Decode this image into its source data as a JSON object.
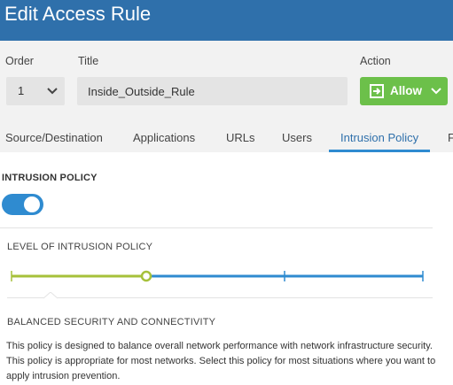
{
  "window": {
    "title": "Edit Access Rule"
  },
  "form": {
    "order_label": "Order",
    "order_value": "1",
    "title_label": "Title",
    "title_value": "Inside_Outside_Rule",
    "action_label": "Action",
    "action_value": "Allow"
  },
  "tabs": [
    {
      "label": "Source/Destination",
      "active": false
    },
    {
      "label": "Applications",
      "active": false
    },
    {
      "label": "URLs",
      "active": false
    },
    {
      "label": "Users",
      "active": false
    },
    {
      "label": "Intrusion Policy",
      "active": true
    },
    {
      "label": "F",
      "active": false
    }
  ],
  "intrusion": {
    "heading": "INTRUSION POLICY",
    "enabled": true,
    "level_heading": "LEVEL OF INTRUSION POLICY",
    "level": {
      "selected_index": 1,
      "positions": 4
    },
    "description_heading": "BALANCED SECURITY AND CONNECTIVITY",
    "description": "This policy is designed to balance overall network performance with network infrastructure security. This policy is appropriate for most networks. Select this policy for most situations where you want to apply intrusion prevention."
  },
  "colors": {
    "header": "#2f70ab",
    "allow": "#6cc04a",
    "accent": "#2f8bd0",
    "slider_active": "#a6c13a"
  },
  "icons": {
    "order_chevron": "chevron-down-icon",
    "allow": "allow-arrow-icon",
    "allow_chevron": "chevron-down-icon"
  }
}
